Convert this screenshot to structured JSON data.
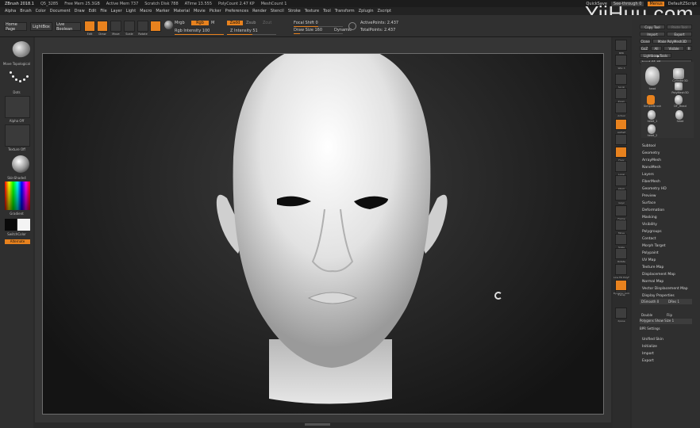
{
  "titlebar": {
    "app": "ZBrush 2018.1",
    "stats": [
      "Q5_3285",
      "Free Mem 25.3GB",
      "Active Mem 737",
      "Scratch Disk 788",
      "ATime 13.555",
      "PolyCount 2.47 KP",
      "MeshCount 1"
    ],
    "quicksave": "QuickSave",
    "see_through": "See-through 0",
    "menus": "Menus",
    "script": "DefaultZScript"
  },
  "watermark": "YiiHuu.com",
  "menubar": [
    "Alpha",
    "Brush",
    "Color",
    "Document",
    "Draw",
    "Edit",
    "File",
    "Layer",
    "Light",
    "Macro",
    "Marker",
    "Material",
    "Movie",
    "Picker",
    "Preferences",
    "Render",
    "Stencil",
    "Stroke",
    "Texture",
    "Tool",
    "Transform",
    "Zplugin",
    "Zscript"
  ],
  "top": {
    "home": "Home Page",
    "lightbox": "LightBox",
    "live_boolean": "Live Boolean",
    "tools": [
      "Edit",
      "Draw",
      "Move",
      "Scale",
      "Rotate"
    ],
    "mrgb": "Mrgb",
    "rgb": "Rgb",
    "m": "M",
    "rgb_intensity_label": "Rgb Intensity",
    "rgb_intensity_value": "100",
    "rgb_intensity_fraction": 1.0,
    "zadd": "Zadd",
    "zsub": "Zsub",
    "zcut": "Zcut",
    "z_intensity_label": "Z Intensity",
    "z_intensity_value": "51",
    "z_intensity_fraction": 0.51,
    "focal_shift": "Focal Shift 0",
    "draw_size": "Draw Size 160",
    "dynamic": "Dynamic",
    "active_points": "ActivePoints: 2.437",
    "total_points": "TotalPoints: 2.437"
  },
  "left": {
    "brush": "Move Topological",
    "stroke": "Dots",
    "alpha": "Alpha Off",
    "texture": "Texture Off",
    "material": "SkinShade4",
    "gradient": "Gradient",
    "switch_color": "SwitchColor",
    "alternate": "Alternate"
  },
  "right_shelf": [
    "BPR",
    "SPix 3",
    "Scroll",
    "Zoom",
    "Actual",
    "AAHalf",
    "Persp",
    "Floor",
    "Local",
    "LSym",
    "Gxyz",
    "Frame",
    "Move",
    "Scale",
    "Rotate",
    "Line Fill PolyF",
    "Transp",
    "Dynamic Solo",
    "Xpose"
  ],
  "tray": {
    "copy_tool": "Copy Tool",
    "paste_tool": "Paste Tool",
    "import": "Import",
    "export": "Export",
    "clone": "Clone",
    "make_polymesh": "Make PolyMesh3D",
    "goz": "GoZ",
    "all": "All",
    "visible": "Visible",
    "r": "R",
    "lightbox_tools": "Lightbox▶Tools",
    "head_label": "head_01",
    "head_count": "48",
    "subtools": [
      "head",
      "Cylinder3D",
      "PolyMesh3D",
      "SimpleBrush",
      "DF_Head",
      "head_1",
      "head",
      "head_2"
    ],
    "menu": [
      "Subtool",
      "Geometry",
      "ArrayMesh",
      "NanoMesh",
      "Layers",
      "FiberMesh",
      "Geometry HD",
      "Preview",
      "Surface",
      "Deformation",
      "Masking",
      "Visibility",
      "Polygroups",
      "Contact",
      "Morph Target",
      "Polypaint",
      "UV Map",
      "Texture Map",
      "Displacement Map",
      "Normal Map",
      "Vector Displacement Map",
      "Display Properties"
    ],
    "dsmooth": "DSmooth 0",
    "dres": "DRes 1",
    "double": "Double",
    "flip": "Flip",
    "poly_show_size": "Polygons Show Size 1",
    "bpr_settings": "BPR Settings",
    "bottom": [
      "Unified Skin",
      "Initialize",
      "Import",
      "Export"
    ]
  }
}
